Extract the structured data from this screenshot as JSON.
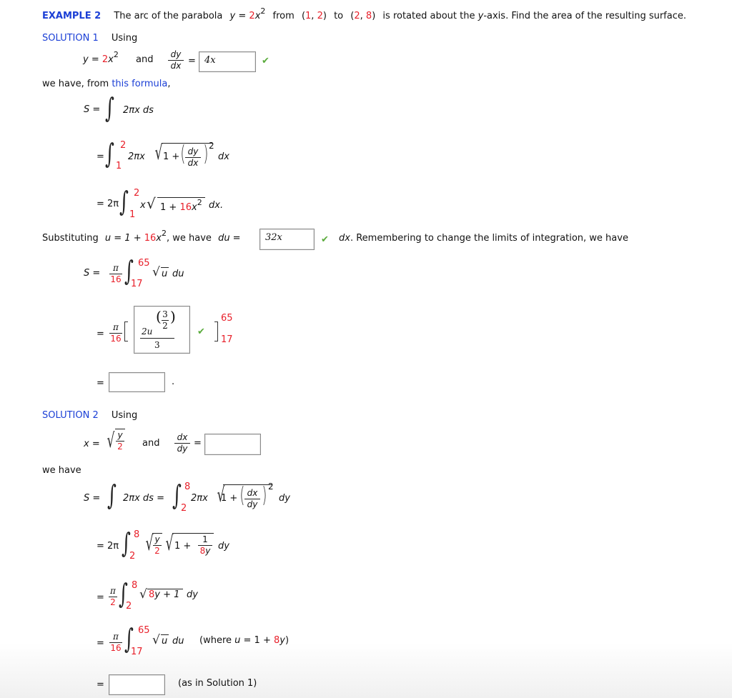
{
  "header": {
    "example_label": "EXAMPLE 2",
    "problem_text_1": "The arc of the parabola",
    "problem_eq_y": "y",
    "problem_eq_eq": "=",
    "problem_coef": "2",
    "problem_x": "x",
    "problem_exp": "2",
    "from": "from",
    "point1_open": "(",
    "point1_x": "1",
    "point1_comma": ",",
    "point1_y": "2",
    "point1_close": ")",
    "to": "to",
    "point2_x": "2",
    "point2_y": "8",
    "problem_text_2": "is rotated about the",
    "axis_var": "y",
    "problem_text_3": "-axis. Find the area of the resulting surface."
  },
  "solution1": {
    "label": "SOLUTION 1",
    "using": "Using",
    "eq_y": "y = ",
    "eq_coef": "2",
    "eq_x": "x",
    "eq_exp": "2",
    "and": "and",
    "deriv_num": "dy",
    "deriv_den": "dx",
    "equals": "=",
    "dydx_answer": {
      "value": "4x",
      "status": "correct"
    },
    "we_have_prefix": "we have, from",
    "formula_link": "this formula",
    "we_have_suffix": ",",
    "line1": {
      "lhs": "S =",
      "integrand": "2πx ds"
    },
    "line2": {
      "eq": "=",
      "upper": "2",
      "lower": "1",
      "pre": "2πx",
      "one_plus": "1 +",
      "frac_num": "dy",
      "frac_den": "dx",
      "exp": "2",
      "diff": "dx"
    },
    "line3": {
      "eq": "= 2π",
      "upper": "2",
      "lower": "1",
      "pre": "x",
      "one_plus": "1 +",
      "coef": "16",
      "var": "x",
      "exp": "2",
      "diff": "dx."
    },
    "subst": {
      "prefix": "Substituting",
      "u_eq": "u = 1 + ",
      "coef": "16",
      "var": "x",
      "exp": "2",
      "mid": ", we have",
      "du_eq": "du =",
      "du_answer": {
        "value": "32x",
        "status": "correct"
      },
      "suffix_var": "dx",
      "suffix": ". Remembering to change the limits of integration, we have"
    },
    "line4": {
      "lhs": "S =",
      "pi": "π",
      "den": "16",
      "upper": "65",
      "lower": "17",
      "integrand_u": "u",
      "diff": "du"
    },
    "line5": {
      "eq": "=",
      "pi": "π",
      "den": "16",
      "antiderivative_answer": {
        "coef": "2u",
        "exp_num": "3",
        "exp_den": "2",
        "den": "3",
        "status": "correct"
      },
      "upper": "65",
      "lower": "17"
    },
    "line6": {
      "eq": "=",
      "final_answer": {
        "value": "",
        "status": "empty"
      },
      "period": "."
    }
  },
  "solution2": {
    "label": "SOLUTION 2",
    "using": "Using",
    "eq_x": "x =",
    "sqrt_num": "y",
    "sqrt_den": "2",
    "and": "and",
    "deriv_num": "dx",
    "deriv_den": "dy",
    "equals": "=",
    "dxdy_answer": {
      "value": "",
      "status": "empty"
    },
    "we_have": "we have",
    "line1": {
      "lhs": "S =",
      "integrand": "2πx ds =",
      "upper": "8",
      "lower": "2",
      "pre": "2πx",
      "one_plus": "1 +",
      "frac_num": "dx",
      "frac_den": "dy",
      "exp": "2",
      "diff": "dy"
    },
    "line2": {
      "eq": "= 2π",
      "upper": "8",
      "lower": "2",
      "sq_num": "y",
      "sq_den": "2",
      "one_plus": "1 +",
      "f_num": "1",
      "f_den_coef": "8",
      "f_den_var": "y",
      "diff": "dy"
    },
    "line3": {
      "eq": "=",
      "pi": "π",
      "den": "2",
      "upper": "8",
      "lower": "2",
      "coef": "8",
      "rest": "y + 1",
      "diff": "dy"
    },
    "line4": {
      "eq": "=",
      "pi": "π",
      "den": "16",
      "upper": "65",
      "lower": "17",
      "integrand_u": "u",
      "diff": "du",
      "note_prefix": "(where ",
      "note_u": "u",
      "note_eq": " = 1 + ",
      "note_coef": "8",
      "note_var": "y",
      "note_close": ")"
    },
    "line5": {
      "eq": "=",
      "final_answer": {
        "value": "",
        "status": "empty"
      },
      "note": "(as in Solution 1)"
    }
  },
  "colors": {
    "label_blue": "#1b3fd6",
    "highlight_red": "#e8202a",
    "check_green": "#5aab3c"
  }
}
